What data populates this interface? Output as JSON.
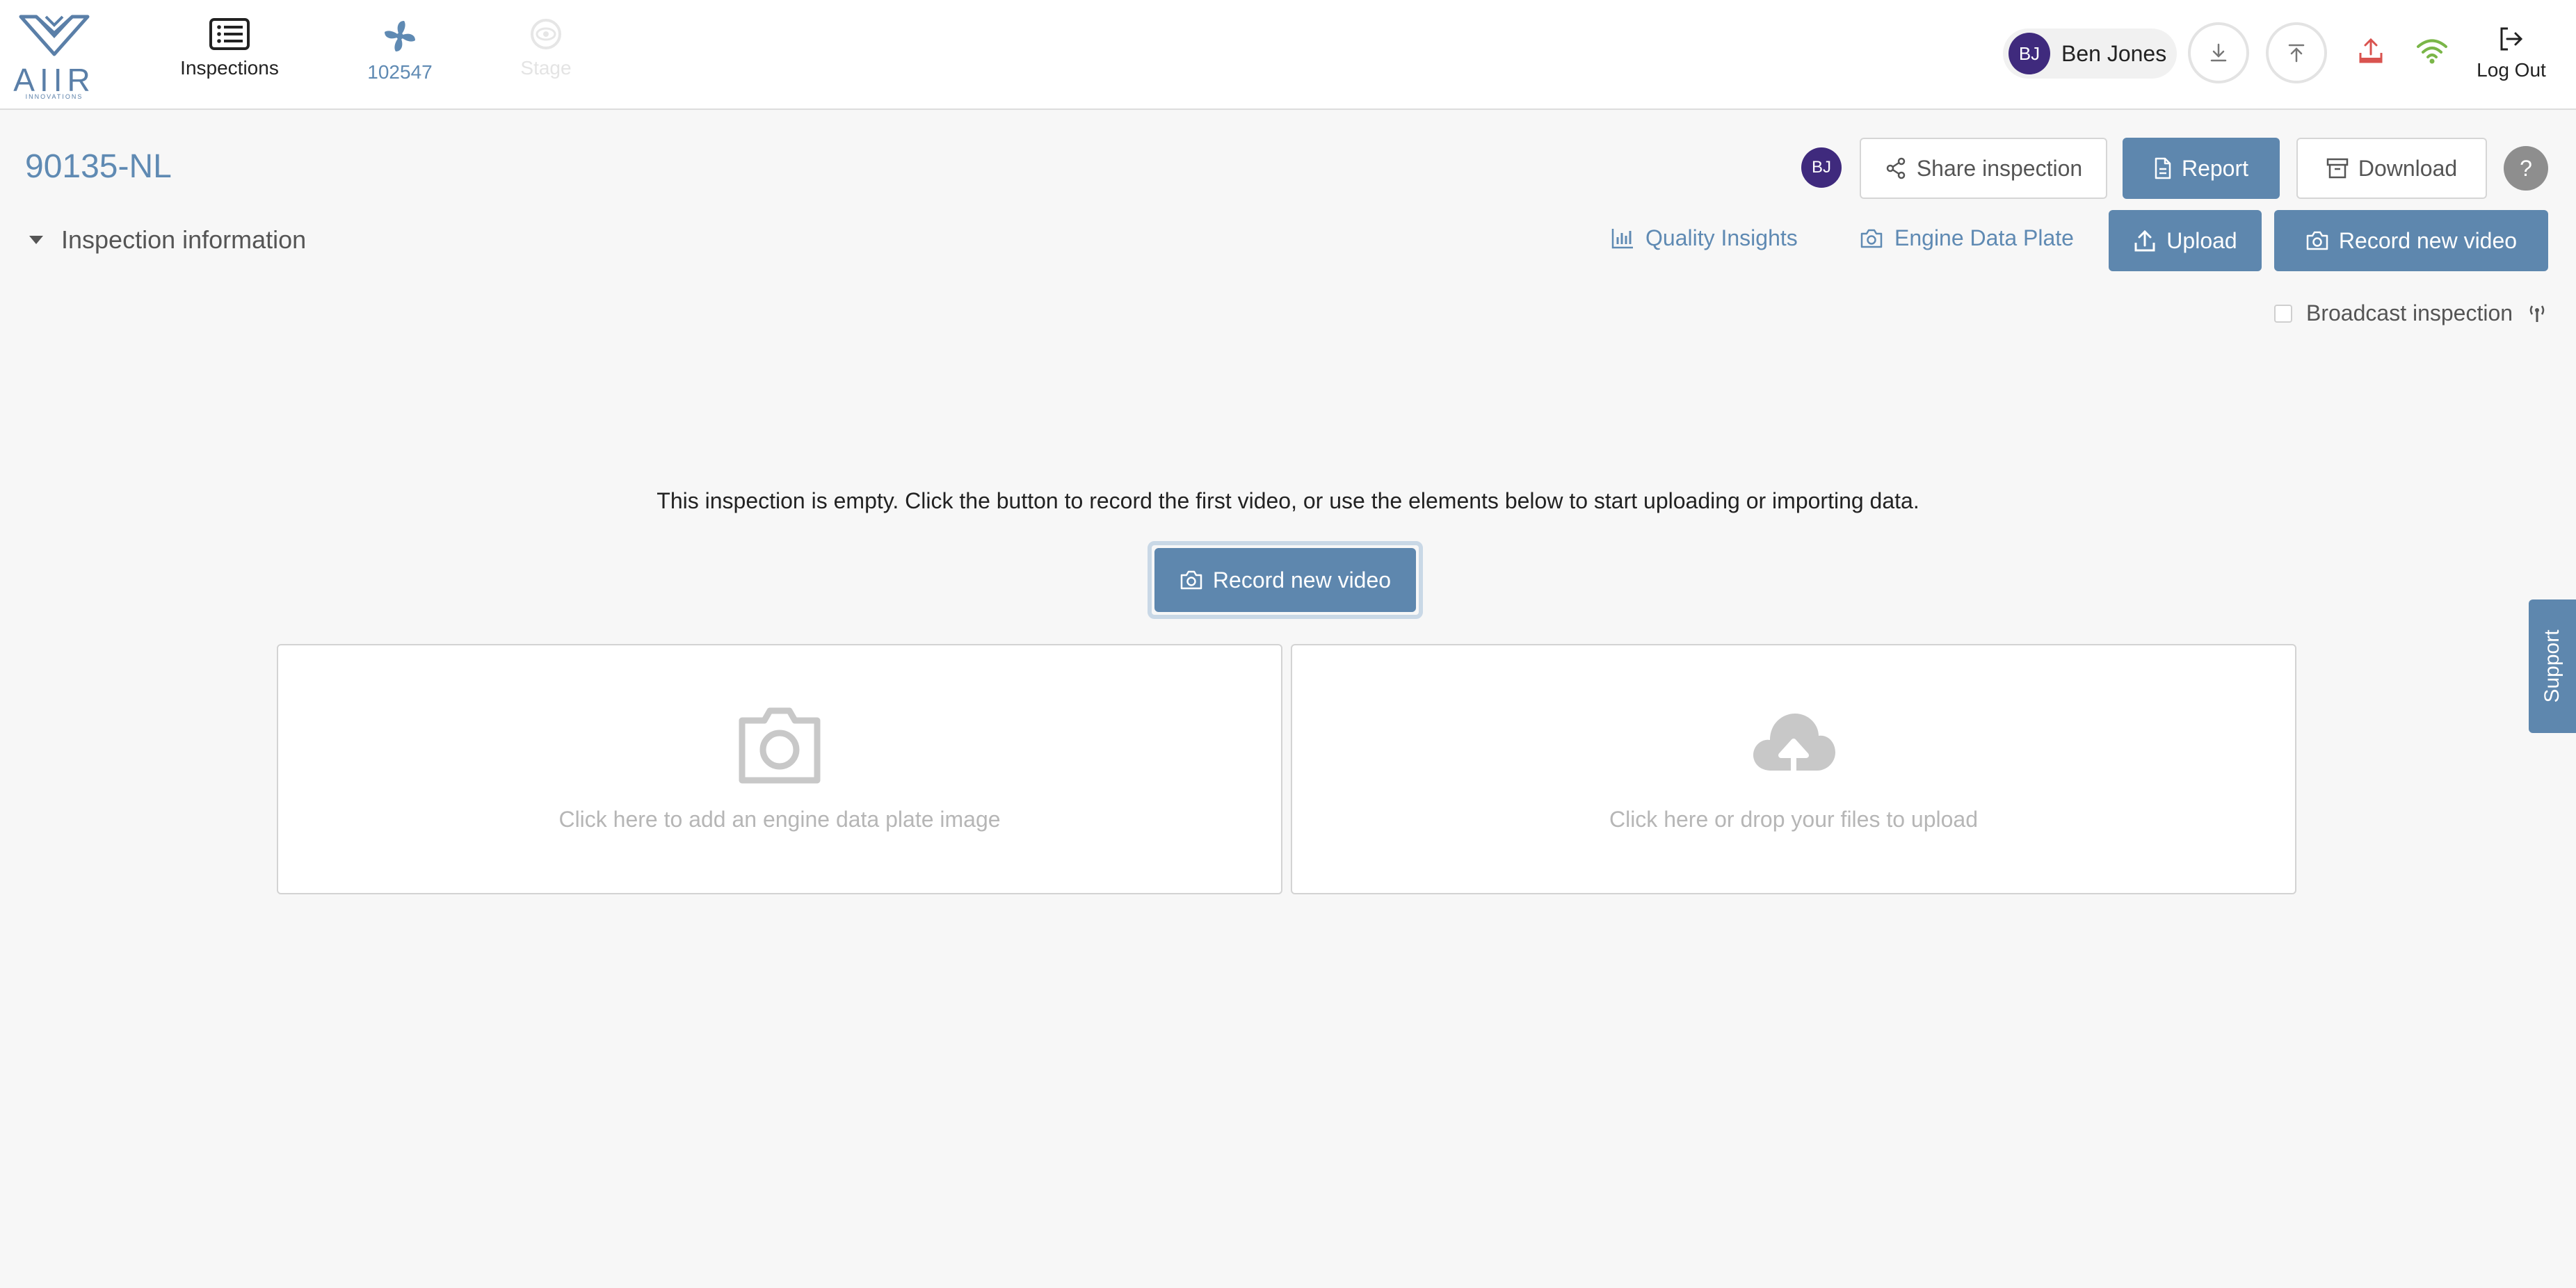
{
  "app": {
    "logo_text": "AIIR",
    "logo_subtext": "INNOVATIONS",
    "brand_color": "#5f8ab3",
    "accent_color": "#5e87ae"
  },
  "nav": {
    "inspections_label": "Inspections",
    "engine_label": "102547",
    "stage_label": "Stage",
    "icons": {
      "inspections": "list-icon",
      "engine": "fan-icon",
      "stage": "eye-icon"
    }
  },
  "user": {
    "initials": "BJ",
    "name": "Ben Jones",
    "avatar_color": "#3f2a7d"
  },
  "toolbar": {
    "logout_label": "Log Out",
    "icons": [
      "download-icon",
      "upload-icon",
      "upload-alert-icon",
      "wifi-icon",
      "logout-icon"
    ],
    "upload_alert_color": "#d9534f",
    "wifi_color": "#7ab648"
  },
  "inspection": {
    "title": "90135-NL",
    "avatar_initials": "BJ",
    "share_label": "Share inspection",
    "report_label": "Report",
    "download_label": "Download",
    "help_label": "?"
  },
  "section": {
    "info_label": "Inspection information",
    "quality_label": "Quality Insights",
    "plate_label": "Engine Data Plate",
    "upload_label": "Upload",
    "record_label": "Record new video",
    "broadcast_label": "Broadcast inspection"
  },
  "empty": {
    "message": "This inspection is empty. Click the button to record the first video, or use the elements below to start uploading or importing data.",
    "record_label": "Record new video",
    "plate_card_text": "Click here to add an engine data plate image",
    "upload_card_text": "Click here or drop your files to upload"
  },
  "support": {
    "label": "Support"
  }
}
